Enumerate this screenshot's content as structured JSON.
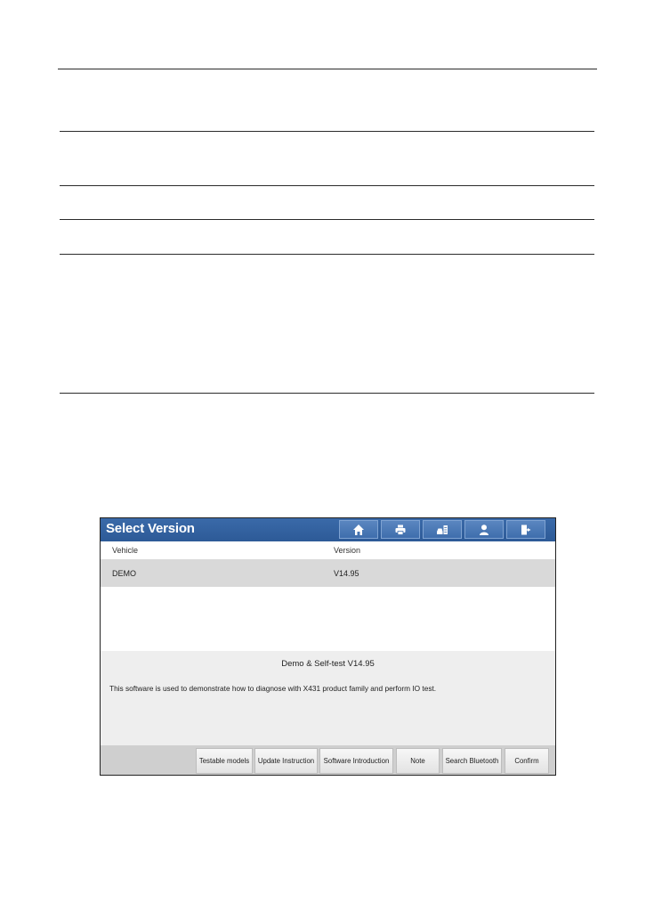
{
  "app": {
    "title": "Select Version",
    "toolbar_icons": [
      "home-icon",
      "print-icon",
      "vehicle-report-icon",
      "user-icon",
      "exit-icon"
    ]
  },
  "table": {
    "columns": [
      "Vehicle",
      "Version"
    ],
    "rows": [
      {
        "vehicle": "DEMO",
        "version": "V14.95"
      }
    ]
  },
  "description": {
    "title": "Demo & Self-test V14.95",
    "text": "This software is used to demonstrate how to diagnose with X431 product family and perform IO test."
  },
  "bottom_buttons": [
    "Testable models",
    "Update Instruction",
    "Software Introduction",
    "Note",
    "Search Bluetooth",
    "Confirm"
  ],
  "colors": {
    "title_bar": "#2d5a97",
    "selected_row": "#d9d9d9",
    "description_bg": "#eeeeee",
    "bottom_bar": "#cfcfcf"
  }
}
